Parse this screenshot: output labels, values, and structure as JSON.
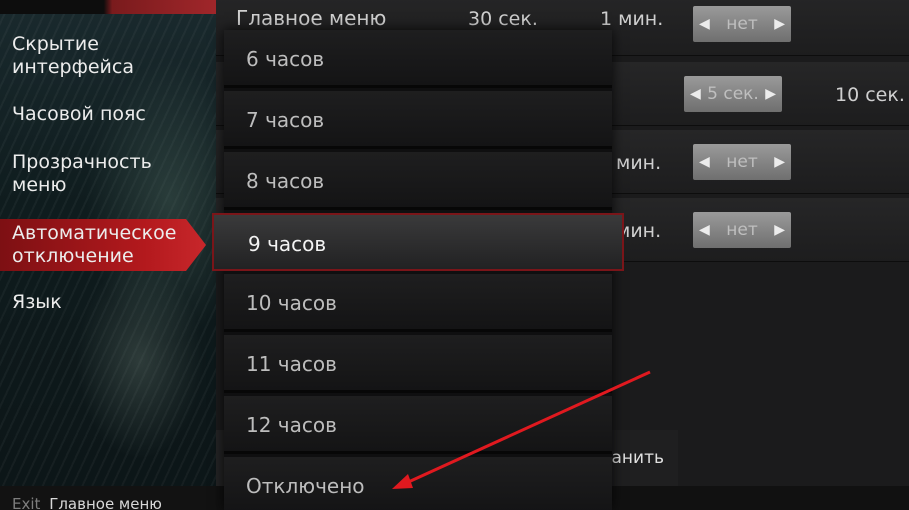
{
  "sidebar": {
    "items": [
      {
        "label": "Скрытие интерфейса"
      },
      {
        "label": "Часовой пояс"
      },
      {
        "label": "Прозрачность меню"
      },
      {
        "label": "Автоматическое отключение"
      },
      {
        "label": "Язык"
      }
    ],
    "footer": {
      "exit": "Exit",
      "menu": "Главное меню"
    }
  },
  "panel": {
    "row1": {
      "label": "Главное меню",
      "val1": "30 сек.",
      "val2": "1 мин.",
      "stepper": "нет"
    },
    "row2": {
      "stepper": "5 сек.",
      "val": "10 сек."
    },
    "row3": {
      "val": "мин.",
      "stepper": "нет"
    },
    "row4": {
      "val": "мин.",
      "stepper": "нет"
    },
    "save_label": "ранить"
  },
  "dropdown": {
    "items": [
      "6 часов",
      "7 часов",
      "8 часов",
      "9 часов",
      "10 часов",
      "11 часов",
      "12 часов",
      "Отключено"
    ],
    "selected_index": 3
  },
  "colors": {
    "accent": "#b3191d",
    "annotation": "#e0191f"
  }
}
